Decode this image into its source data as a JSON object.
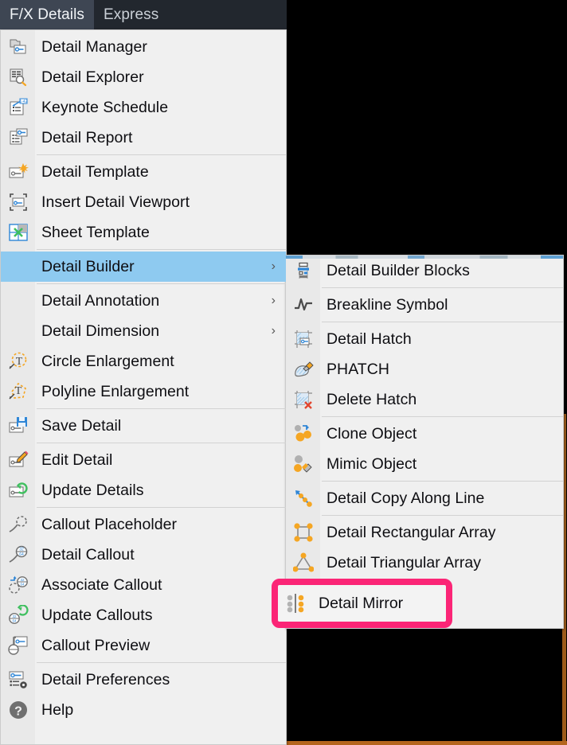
{
  "menubar": {
    "items": [
      {
        "label": "F/X Details",
        "active": true
      },
      {
        "label": "Express",
        "active": false
      }
    ]
  },
  "colors": {
    "menu_bg": "#f0f0f0",
    "gutter_bg": "#e9e9e9",
    "highlight_row": "#8ecaf0",
    "menubar_bg": "#22272e",
    "menubar_active": "#3e4653",
    "annotation_pink": "#fb2576",
    "drawing_border_orange": "#b5651d",
    "icon_blue": "#2f86d6",
    "icon_orange": "#f5a623",
    "icon_green": "#3fbf5f",
    "icon_gray": "#9a9a9a",
    "icon_red": "#e2462f"
  },
  "main_menu": {
    "items": [
      {
        "label": "Detail Manager",
        "icon": "detail-manager-icon",
        "submenu": false,
        "separator_after": false
      },
      {
        "label": "Detail Explorer",
        "icon": "detail-explorer-icon",
        "submenu": false,
        "separator_after": false
      },
      {
        "label": "Keynote Schedule",
        "icon": "keynote-schedule-icon",
        "submenu": false,
        "separator_after": false
      },
      {
        "label": "Detail Report",
        "icon": "detail-report-icon",
        "submenu": false,
        "separator_after": true
      },
      {
        "label": "Detail Template",
        "icon": "detail-template-icon",
        "submenu": false,
        "separator_after": false
      },
      {
        "label": "Insert Detail Viewport",
        "icon": "insert-detail-viewport-icon",
        "submenu": false,
        "separator_after": false
      },
      {
        "label": "Sheet Template",
        "icon": "sheet-template-icon",
        "submenu": false,
        "separator_after": true
      },
      {
        "label": "Detail Builder",
        "icon": "none",
        "submenu": true,
        "separator_after": true,
        "highlighted": true
      },
      {
        "label": "Detail Annotation",
        "icon": "none",
        "submenu": true,
        "separator_after": false
      },
      {
        "label": "Detail Dimension",
        "icon": "none",
        "submenu": true,
        "separator_after": false
      },
      {
        "label": "Circle Enlargement",
        "icon": "circle-enlargement-icon",
        "submenu": false,
        "separator_after": false
      },
      {
        "label": "Polyline Enlargement",
        "icon": "polyline-enlargement-icon",
        "submenu": false,
        "separator_after": true
      },
      {
        "label": "Save Detail",
        "icon": "save-detail-icon",
        "submenu": false,
        "separator_after": true
      },
      {
        "label": "Edit Detail",
        "icon": "edit-detail-icon",
        "submenu": false,
        "separator_after": false
      },
      {
        "label": "Update Details",
        "icon": "update-details-icon",
        "submenu": false,
        "separator_after": true
      },
      {
        "label": "Callout Placeholder",
        "icon": "callout-placeholder-icon",
        "submenu": false,
        "separator_after": false
      },
      {
        "label": "Detail Callout",
        "icon": "detail-callout-icon",
        "submenu": false,
        "separator_after": false
      },
      {
        "label": "Associate Callout",
        "icon": "associate-callout-icon",
        "submenu": false,
        "separator_after": false
      },
      {
        "label": "Update Callouts",
        "icon": "update-callouts-icon",
        "submenu": false,
        "separator_after": false
      },
      {
        "label": "Callout Preview",
        "icon": "callout-preview-icon",
        "submenu": false,
        "separator_after": true
      },
      {
        "label": "Detail Preferences",
        "icon": "detail-preferences-icon",
        "submenu": false,
        "separator_after": false
      },
      {
        "label": "Help",
        "icon": "help-icon",
        "submenu": false,
        "separator_after": false
      }
    ]
  },
  "sub_menu": {
    "parent": "Detail Builder",
    "items": [
      {
        "label": "Detail Builder Blocks",
        "icon": "detail-builder-blocks-icon",
        "separator_after": true
      },
      {
        "label": "Breakline Symbol",
        "icon": "breakline-symbol-icon",
        "separator_after": true
      },
      {
        "label": "Detail Hatch",
        "icon": "detail-hatch-icon",
        "separator_after": false
      },
      {
        "label": "PHATCH",
        "icon": "phatch-icon",
        "separator_after": false
      },
      {
        "label": "Delete Hatch",
        "icon": "delete-hatch-icon",
        "separator_after": true
      },
      {
        "label": "Clone Object",
        "icon": "clone-object-icon",
        "separator_after": false
      },
      {
        "label": "Mimic Object",
        "icon": "mimic-object-icon",
        "separator_after": true
      },
      {
        "label": "Detail Copy Along Line",
        "icon": "detail-copy-along-line-icon",
        "separator_after": true
      },
      {
        "label": "Detail Rectangular Array",
        "icon": "detail-rectangular-array-icon",
        "separator_after": false
      },
      {
        "label": "Detail Triangular Array",
        "icon": "detail-triangular-array-icon",
        "separator_after": false
      },
      {
        "label": "Detail Mirror",
        "icon": "detail-mirror-icon",
        "separator_after": false,
        "annotated": true
      }
    ]
  },
  "annotation": {
    "target_label": "Detail Mirror",
    "shape": "rounded-rectangle",
    "color": "#fb2576"
  }
}
